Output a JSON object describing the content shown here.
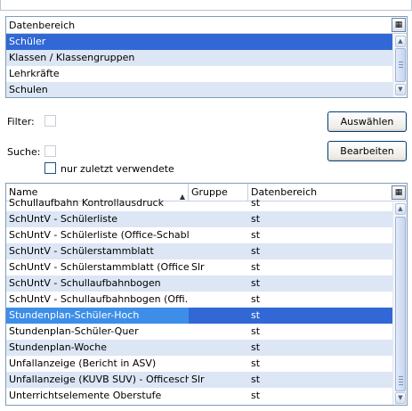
{
  "datenbereich": {
    "header": "Datenbereich",
    "items": [
      "Schüler",
      "Klassen / Klassengruppen",
      "Lehrkräfte",
      "Schulen"
    ],
    "selected_index": 0
  },
  "filter": {
    "label": "Filter:",
    "button": "Auswählen"
  },
  "suche": {
    "label": "Suche:",
    "button": "Bearbeiten",
    "recent_checkbox_label": "nur zuletzt verwendete",
    "recent_checked": false
  },
  "table": {
    "columns": [
      "Name",
      "Gruppe",
      "Datenbereich"
    ],
    "sort_column": "Name",
    "rows": [
      {
        "name": "Schullaufbahn Kontrollausdruck",
        "gruppe": "",
        "bereich": "st"
      },
      {
        "name": "SchUntV - Schülerliste",
        "gruppe": "",
        "bereich": "st"
      },
      {
        "name": "SchUntV - Schülerliste (Office-Schabl...",
        "gruppe": "",
        "bereich": "st"
      },
      {
        "name": "SchUntV - Schülerstammblatt",
        "gruppe": "",
        "bereich": "st"
      },
      {
        "name": "SchUntV - Schülerstammblatt (Office ...",
        "gruppe": "Slr",
        "bereich": "st"
      },
      {
        "name": "SchUntV - Schullaufbahnbogen",
        "gruppe": "",
        "bereich": "st"
      },
      {
        "name": "SchUntV - Schullaufbahnbogen (Offi...",
        "gruppe": "",
        "bereich": "st"
      },
      {
        "name": "Stundenplan-Schüler-Hoch",
        "gruppe": "",
        "bereich": "st"
      },
      {
        "name": "Stundenplan-Schüler-Quer",
        "gruppe": "",
        "bereich": "st"
      },
      {
        "name": "Stundenplan-Woche",
        "gruppe": "",
        "bereich": "st"
      },
      {
        "name": "Unfallanzeige (Bericht in ASV)",
        "gruppe": "",
        "bereich": "st"
      },
      {
        "name": "Unfallanzeige (KUVB SUV) - Officesch...",
        "gruppe": "Slr",
        "bereich": "st"
      },
      {
        "name": "Unterrichtselemente Oberstufe",
        "gruppe": "",
        "bereich": "st"
      }
    ],
    "selected_index": 7
  },
  "icons": {
    "column_chooser": "column-chooser-icon",
    "sort": "sort-ascending-icon",
    "scroll_up": "scroll-up-icon",
    "scroll_down": "scroll-down-icon"
  },
  "colors": {
    "selection": "#3168d5",
    "selection_cell": "#3d8ee8",
    "alt_row": "#dce6f4",
    "border": "#7f9db9"
  }
}
